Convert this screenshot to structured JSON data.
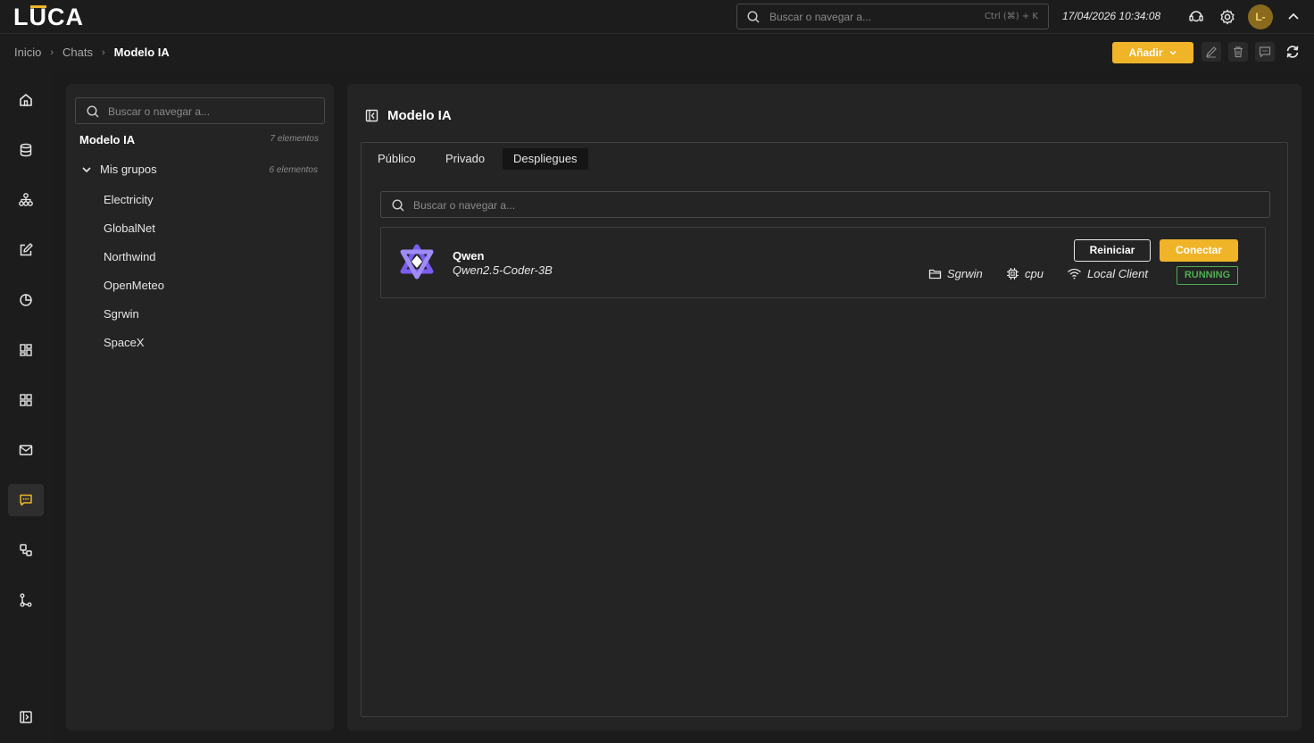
{
  "app": {
    "logo": "LŪCA",
    "logo_parts": [
      "L",
      "U",
      "CA"
    ]
  },
  "topbar": {
    "search_placeholder": "Buscar o navegar a...",
    "search_shortcut": "Ctrl (⌘) + K",
    "datetime": "17/04/2026 10:34:08",
    "avatar_initials": "L-"
  },
  "breadcrumb": {
    "items": [
      "Inicio",
      "Chats"
    ],
    "current": "Modelo IA"
  },
  "toolbar": {
    "add_label": "Añadir"
  },
  "sidebar": {
    "items": [
      "home",
      "database",
      "hierarchy",
      "edit",
      "pie-chart",
      "dashboard",
      "grid",
      "mail",
      "chat",
      "shapes",
      "git-branch"
    ],
    "active": "chat"
  },
  "tree": {
    "search_placeholder": "Buscar o navegar a...",
    "title": "Modelo IA",
    "title_count": "7 elementos",
    "group": {
      "label": "Mis grupos",
      "count": "6 elementos"
    },
    "items": [
      "Electricity",
      "GlobalNet",
      "Northwind",
      "OpenMeteo",
      "Sgrwin",
      "SpaceX"
    ]
  },
  "main": {
    "title": "Modelo IA",
    "tabs": [
      "Público",
      "Privado",
      "Despliegues"
    ],
    "active_tab": "Despliegues",
    "search_placeholder": "Buscar o navegar a...",
    "deployment": {
      "name": "Qwen",
      "model": "Qwen2.5-Coder-3B",
      "restart_label": "Reiniciar",
      "connect_label": "Conectar",
      "group": "Sgrwin",
      "device": "cpu",
      "client": "Local Client",
      "status": "RUNNING"
    }
  },
  "colors": {
    "accent": "#f0b429",
    "running": "#4caf50",
    "background": "#1b1b1b",
    "panel": "#242424"
  }
}
